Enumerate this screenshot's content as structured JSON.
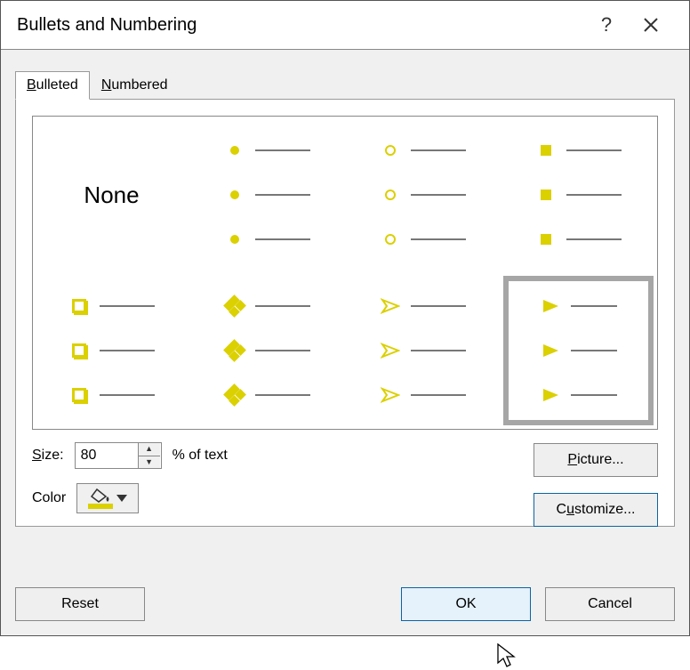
{
  "title": "Bullets and Numbering",
  "help_symbol": "?",
  "tabs": {
    "bulleted": {
      "label": "Bulleted",
      "ukey": "B"
    },
    "numbered": {
      "label": "Numbered",
      "ukey": "N"
    },
    "active": "bulleted"
  },
  "bullet_options": [
    {
      "id": "none",
      "type": "none",
      "label": "None"
    },
    {
      "id": "filled_dot",
      "type": "dot"
    },
    {
      "id": "open_circle",
      "type": "circle"
    },
    {
      "id": "filled_square",
      "type": "square"
    },
    {
      "id": "shadow_box",
      "type": "boxout"
    },
    {
      "id": "four_diamonds",
      "type": "diamonds"
    },
    {
      "id": "arrowhead_outline",
      "type": "arrow_outline"
    },
    {
      "id": "arrowhead_solid",
      "type": "arrow_solid",
      "selected": true
    }
  ],
  "size": {
    "label": "Size:",
    "ukey": "S",
    "value": "80",
    "suffix": "% of text"
  },
  "color": {
    "label": "Color",
    "value": "#dbd000"
  },
  "buttons": {
    "picture": {
      "label": "Picture...",
      "ukey": "P"
    },
    "customize": {
      "label": "Customize...",
      "ukey": "C"
    },
    "reset": "Reset",
    "ok": "OK",
    "cancel": "Cancel"
  }
}
